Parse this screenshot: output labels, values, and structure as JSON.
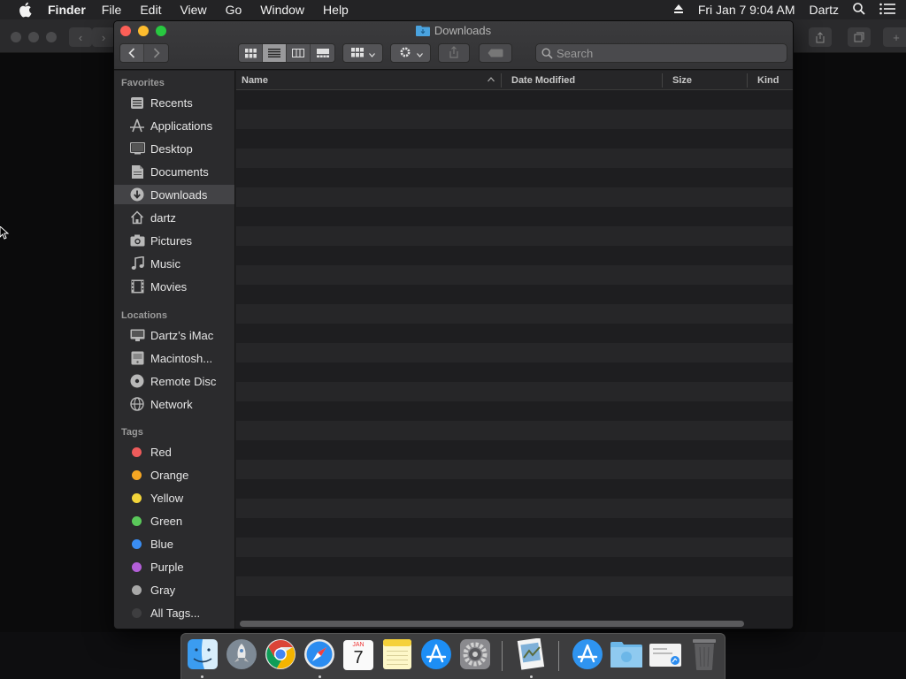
{
  "menubar": {
    "app_name": "Finder",
    "menus": [
      "File",
      "Edit",
      "View",
      "Go",
      "Window",
      "Help"
    ],
    "datetime": "Fri Jan 7  9:04 AM",
    "user": "Dartz"
  },
  "window": {
    "title": "Downloads",
    "search_placeholder": "Search"
  },
  "sidebar": {
    "favorites_header": "Favorites",
    "favorites": [
      {
        "label": "Recents",
        "icon": "recents-icon"
      },
      {
        "label": "Applications",
        "icon": "applications-icon"
      },
      {
        "label": "Desktop",
        "icon": "desktop-icon"
      },
      {
        "label": "Documents",
        "icon": "documents-icon"
      },
      {
        "label": "Downloads",
        "icon": "downloads-icon",
        "selected": true
      },
      {
        "label": "dartz",
        "icon": "home-icon"
      },
      {
        "label": "Pictures",
        "icon": "pictures-icon"
      },
      {
        "label": "Music",
        "icon": "music-icon"
      },
      {
        "label": "Movies",
        "icon": "movies-icon"
      }
    ],
    "locations_header": "Locations",
    "locations": [
      {
        "label": "Dartz’s iMac",
        "icon": "imac-icon"
      },
      {
        "label": "Macintosh...",
        "icon": "hard-drive-icon"
      },
      {
        "label": "Remote Disc",
        "icon": "disc-icon"
      },
      {
        "label": "Network",
        "icon": "network-icon"
      }
    ],
    "tags_header": "Tags",
    "tags": [
      {
        "label": "Red",
        "color": "#ee5b5b"
      },
      {
        "label": "Orange",
        "color": "#f5a623"
      },
      {
        "label": "Yellow",
        "color": "#f2d43a"
      },
      {
        "label": "Green",
        "color": "#5ac85a"
      },
      {
        "label": "Blue",
        "color": "#3a8df2"
      },
      {
        "label": "Purple",
        "color": "#b35fd8"
      },
      {
        "label": "Gray",
        "color": "#a8a8a8"
      },
      {
        "label": "All Tags...",
        "color": "#3e3e40"
      }
    ]
  },
  "columns": {
    "name": "Name",
    "date_modified": "Date Modified",
    "size": "Size",
    "kind": "Kind"
  },
  "dock": {
    "items": [
      "finder-icon",
      "launchpad-icon",
      "chrome-icon",
      "safari-icon",
      "calendar-icon",
      "notes-icon",
      "app-store-icon",
      "system-preferences-icon",
      "preview-icon",
      "applications-folder-icon",
      "downloads-folder-icon",
      "documents-stack-icon",
      "trash-icon"
    ],
    "calendar_month": "JAN",
    "calendar_day": "7"
  },
  "colors": {
    "accent_selected": "#434346",
    "close": "#fc5f57",
    "minimize": "#fdbc2e",
    "maximize": "#28c840"
  }
}
